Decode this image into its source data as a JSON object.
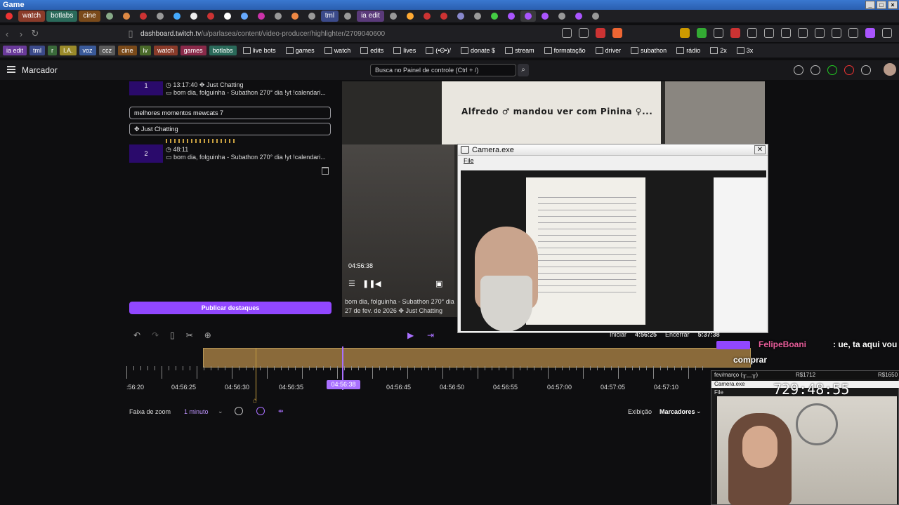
{
  "os": {
    "title": "Game",
    "win_buttons": [
      "_",
      "□",
      "×"
    ]
  },
  "tabs": [
    {
      "label": "watch",
      "color": "#8a3b2a"
    },
    {
      "label": "botlabs",
      "color": "#2a6a5a"
    },
    {
      "label": "cine",
      "color": "#7a4a1a"
    },
    {
      "label": "tml",
      "color": "#3b4a8a"
    },
    {
      "label": "ia edit",
      "color": "#5a3a7a"
    }
  ],
  "address": {
    "domain": "dashboard.twitch.tv",
    "path": "/u/parlasea/content/video-producer/highlighter/2709040600"
  },
  "bookmarks": [
    {
      "label": "ia edit",
      "color": "#6a3a9a"
    },
    {
      "label": "tml",
      "color": "#3b4a8a"
    },
    {
      "label": "r",
      "color": "#3a6a3a"
    },
    {
      "label": "I.A.",
      "color": "#9a8a2a"
    },
    {
      "label": "voz",
      "color": "#3a5a9a"
    },
    {
      "label": "ccz",
      "color": "#5a5a5a"
    },
    {
      "label": "cine",
      "color": "#7a4a1a"
    },
    {
      "label": "lv",
      "color": "#4a6a2a"
    },
    {
      "label": "watch",
      "color": "#8a3b2a"
    },
    {
      "label": "games",
      "color": "#8a2a4a"
    },
    {
      "label": "botlabs",
      "color": "#2a6a5a"
    }
  ],
  "bookmarks_plain": [
    "live bots",
    "games",
    "watch",
    "edits",
    "lives",
    "(•Θ•)/",
    "donate $",
    "stream",
    "formatação",
    "driver",
    "subathon",
    "rádio",
    "2x",
    "3x"
  ],
  "header": {
    "title": "Marcador",
    "search_placeholder": "Busca no Painel de controle (Ctrl + /)"
  },
  "highlights": [
    {
      "num": "1",
      "time": "13:17:40",
      "category": "Just Chatting",
      "title": "bom dia, folguinha - Subathon 270° dia !yt !calendari..."
    },
    {
      "num": "2",
      "time": "48:11",
      "category": "",
      "title": "bom dia, folguinha - Subathon 270° dia !yt !calendari..."
    }
  ],
  "edit": {
    "title_value": "melhores momentos mewcats 7",
    "category_value": "Just Chatting"
  },
  "publish_label": "Publicar destaques",
  "video": {
    "overlay_text": "Alfredo ♂ mandou ver com Pinina ♀...",
    "time": "04:56:38",
    "meta_title": "bom dia, folguinha - Subathon 270° dia",
    "meta_date": "27 de fev. de 2026",
    "meta_category": "Just Chatting"
  },
  "camera": {
    "title": "Camera.exe",
    "menu": "File"
  },
  "timeline": {
    "right": {
      "start_label": "Iniciar",
      "start_time": "4:56:25",
      "end_label": "Encerrar",
      "end_time": "5:37:38"
    },
    "labels": [
      ":56:20",
      "04:56:25",
      "04:56:30",
      "04:56:35",
      "04:56:45",
      "04:56:50",
      "04:56:55",
      "04:57:00",
      "04:57:05",
      "04:57:10"
    ],
    "playhead_label": "04:56:38"
  },
  "zoom": {
    "label": "Faixa de zoom",
    "value": "1 minuto",
    "exibicao": "Exibição",
    "marcadores": "Marcadores"
  },
  "chat": {
    "user": "FelipeBoani",
    "msg1": ": ue, ta aqui vou",
    "msg2": "comprar"
  },
  "streamer": {
    "header_left": "fev/março (╥﹏╥)",
    "header_mid": "R$1712",
    "header_right": "R$1650",
    "counter": "729:48:55",
    "file_label": "File",
    "cam_title": "Camera.exe"
  },
  "accent": "#9147ff"
}
